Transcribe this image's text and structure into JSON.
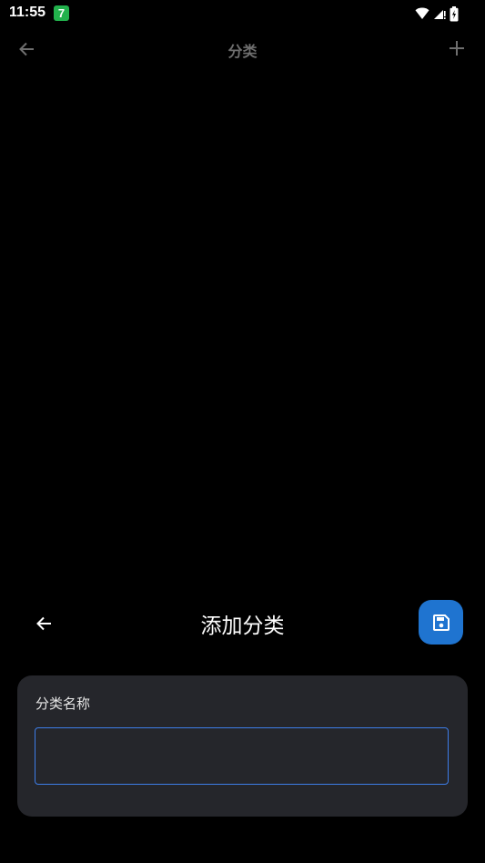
{
  "status_bar": {
    "time": "11:55",
    "app_badge": "7",
    "icons": [
      "wifi-icon",
      "signal-icon",
      "battery-icon"
    ]
  },
  "background_page": {
    "title": "分类",
    "back_icon": "arrow-left-icon",
    "add_icon": "plus-icon"
  },
  "sheet": {
    "title": "添加分类",
    "back_icon": "arrow-left-icon",
    "save_icon": "save-icon",
    "field_label": "分类名称",
    "name_value": "",
    "name_placeholder": ""
  },
  "colors": {
    "background": "#000000",
    "card": "#25262b",
    "accent": "#1f74d0",
    "input_border": "#3d7de8",
    "dim_text": "#6f6f6f"
  }
}
